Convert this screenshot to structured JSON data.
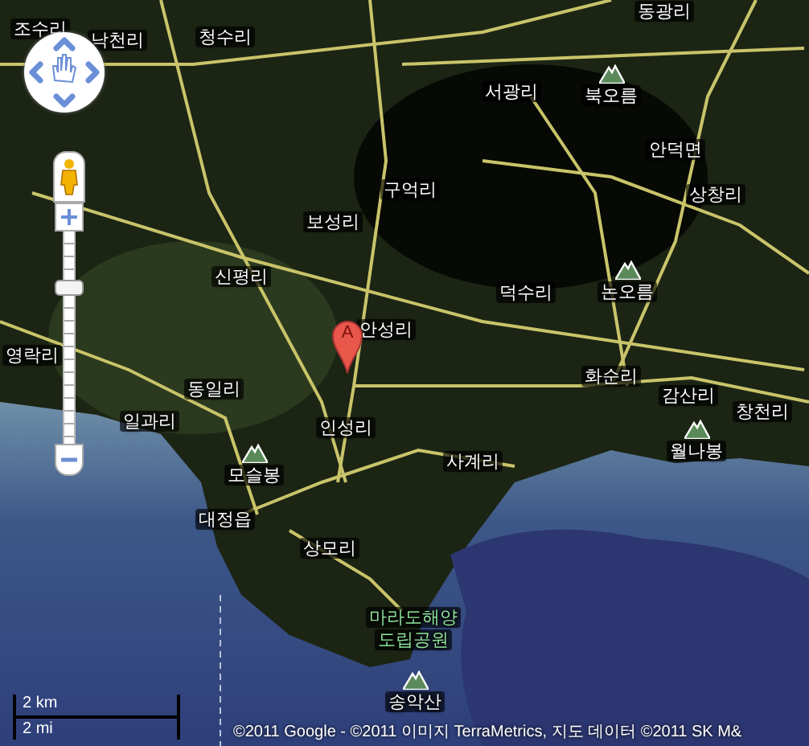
{
  "map": {
    "labels": [
      {
        "text": "조수리",
        "kind": "place"
      },
      {
        "text": "낙천리",
        "kind": "place"
      },
      {
        "text": "청수리",
        "kind": "place"
      },
      {
        "text": "동광리",
        "kind": "place"
      },
      {
        "text": "서광리",
        "kind": "place"
      },
      {
        "text": "북오름",
        "kind": "peak"
      },
      {
        "text": "안덕면",
        "kind": "place"
      },
      {
        "text": "상창리",
        "kind": "place"
      },
      {
        "text": "구억리",
        "kind": "place"
      },
      {
        "text": "보성리",
        "kind": "place"
      },
      {
        "text": "신평리",
        "kind": "place"
      },
      {
        "text": "덕수리",
        "kind": "place"
      },
      {
        "text": "논오름",
        "kind": "peak"
      },
      {
        "text": "안성리",
        "kind": "place"
      },
      {
        "text": "영락리",
        "kind": "place"
      },
      {
        "text": "동일리",
        "kind": "place"
      },
      {
        "text": "화순리",
        "kind": "place"
      },
      {
        "text": "감산리",
        "kind": "place"
      },
      {
        "text": "창천리",
        "kind": "place"
      },
      {
        "text": "월나봉",
        "kind": "peak"
      },
      {
        "text": "일과리",
        "kind": "place"
      },
      {
        "text": "인성리",
        "kind": "place"
      },
      {
        "text": "모슬봉",
        "kind": "peak"
      },
      {
        "text": "사계리",
        "kind": "place"
      },
      {
        "text": "대정읍",
        "kind": "place"
      },
      {
        "text": "상모리",
        "kind": "place"
      },
      {
        "text": "마라도해양",
        "kind": "park"
      },
      {
        "text": "도립공원",
        "kind": "park"
      },
      {
        "text": "송악산",
        "kind": "peak"
      }
    ],
    "marker": {
      "label": "A"
    },
    "zoom": {
      "level": 0.74
    },
    "scale": {
      "metric": "2 km",
      "imperial": "2 mi"
    },
    "attribution": "©2011 Google - ©2011 이미지 TerraMetrics, 지도 데이터 ©2011 SK M&"
  }
}
